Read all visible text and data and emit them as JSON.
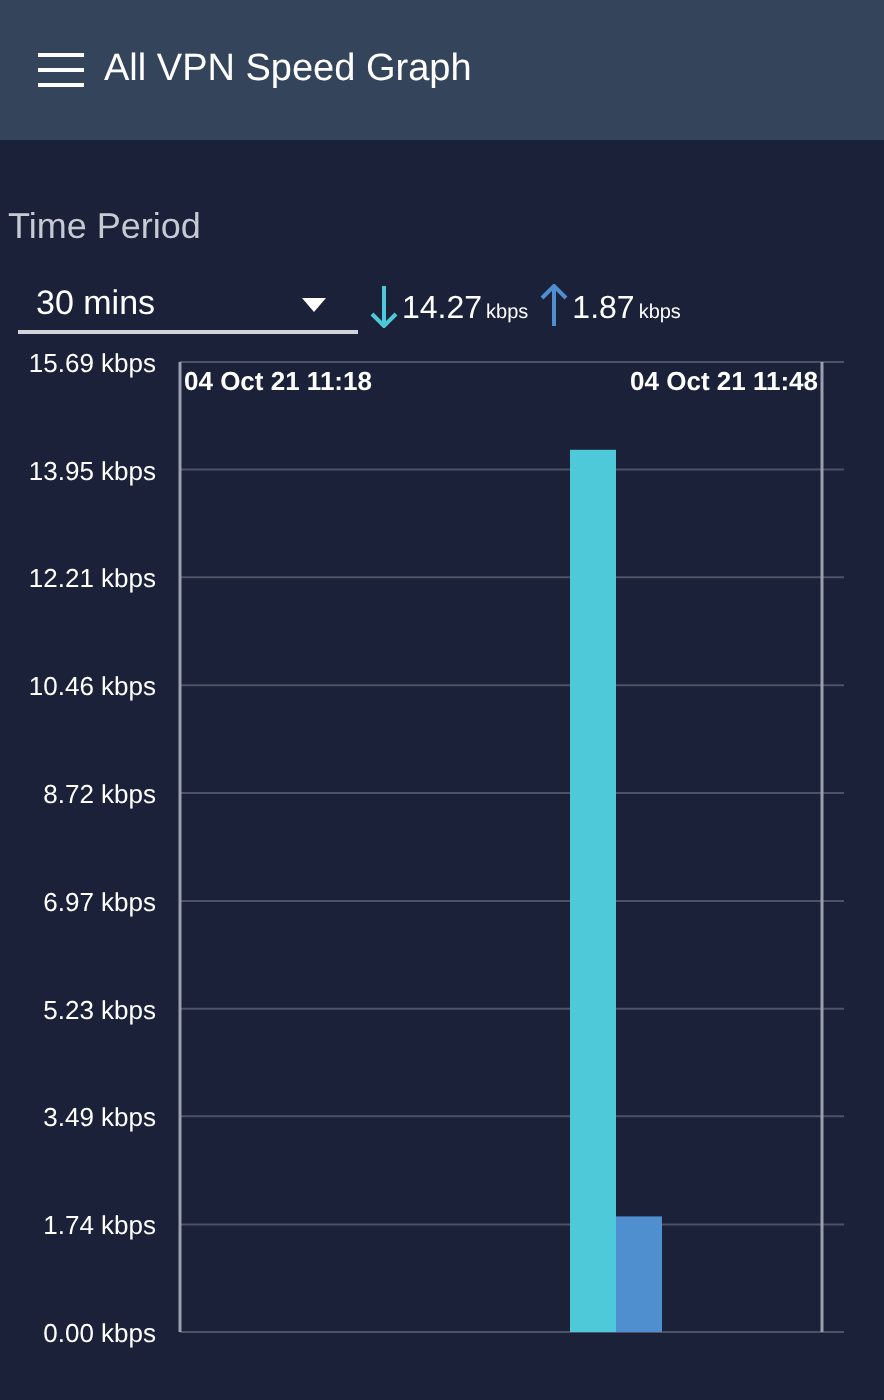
{
  "app_bar": {
    "title": "All VPN Speed Graph"
  },
  "time_period": {
    "label": "Time Period",
    "value": "30 mins"
  },
  "readings": [
    {
      "kind": "download",
      "value": "14.27",
      "unit": "kbps"
    },
    {
      "kind": "upload",
      "value": "1.87",
      "unit": "kbps"
    }
  ],
  "chart": {
    "start_time": "04 Oct 21 11:18",
    "end_time": "04 Oct 21 11:48",
    "chart_data": {
      "type": "bar",
      "grid": true,
      "ylim": [
        0,
        15.69
      ],
      "yticks": [
        {
          "value": 0,
          "label": "0.00 kbps"
        },
        {
          "value": 1.74,
          "label": "1.74 kbps"
        },
        {
          "value": 3.49,
          "label": "3.49 kbps"
        },
        {
          "value": 5.23,
          "label": "5.23 kbps"
        },
        {
          "value": 6.97,
          "label": "6.97 kbps"
        },
        {
          "value": 8.72,
          "label": "8.72 kbps"
        },
        {
          "value": 10.46,
          "label": "10.46 kbps"
        },
        {
          "value": 12.21,
          "label": "12.21 kbps"
        },
        {
          "value": 13.95,
          "label": "13.95 kbps"
        },
        {
          "value": 15.69,
          "label": "15.69 kbps"
        }
      ],
      "series": [
        {
          "color": "#4ec9d9",
          "values": [
            14.27
          ]
        },
        {
          "color": "#4f8fd0",
          "values": [
            1.87
          ]
        }
      ]
    }
  }
}
